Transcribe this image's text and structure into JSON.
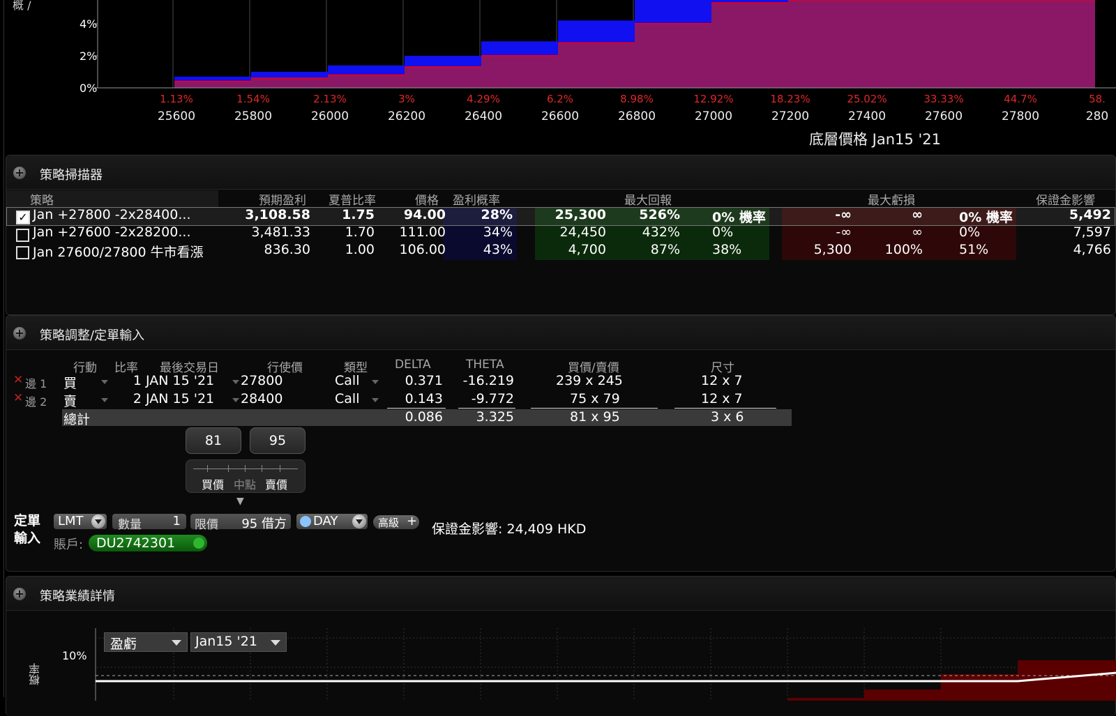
{
  "colors": {
    "profit_fill": "#8a1866",
    "loss_fill": "#1010f0",
    "step_line": "#e00020",
    "percent_red": "#e02828"
  },
  "top_chart": {
    "y_ticks": [
      "4%",
      "2%",
      "0%"
    ],
    "x_ticks": [
      "25600",
      "25800",
      "26000",
      "26200",
      "26400",
      "26600",
      "26800",
      "27000",
      "27200",
      "27400",
      "27600",
      "27800",
      "280"
    ],
    "x_percents": [
      "1.13%",
      "1.54%",
      "2.13%",
      "3%",
      "4.29%",
      "6.2%",
      "8.98%",
      "12.92%",
      "18.23%",
      "25.02%",
      "33.33%",
      "44.7%",
      "58."
    ],
    "xlabel": "底層價格 Jan15 '21"
  },
  "chart_data": {
    "type": "area",
    "x": [
      25500,
      25700,
      25900,
      26100,
      26300,
      26500,
      26700,
      26900,
      27100,
      27300,
      27500,
      27700,
      27900
    ],
    "series": [
      {
        "values": [
          0,
          0.4,
          0.6,
          0.8,
          1.3,
          2.0,
          2.8,
          4.0,
          5.3,
          6.0,
          6.0,
          6.0,
          6.0
        ]
      },
      {
        "values": [
          0,
          0.7,
          1.0,
          1.4,
          2.0,
          2.9,
          4.2,
          6.0,
          6.0,
          6.0,
          6.0,
          6.0,
          6.0
        ]
      }
    ],
    "title": "",
    "xlabel": "底層價格 Jan15 '21",
    "ylabel": "",
    "ylim": [
      0,
      5.5
    ]
  },
  "scanner": {
    "title": "策略掃描器",
    "headers": {
      "strategy": "策略",
      "expected_profit": "預期盈利",
      "sharpe": "夏普比率",
      "price": "價格",
      "pop": "盈利概率",
      "max_return": "最大回報",
      "max_loss": "最大虧損",
      "margin": "保證金影響"
    },
    "rows": [
      {
        "checked": true,
        "name": "Jan +27800 -2x28400...",
        "expected": "3,108.58",
        "sharpe": "1.75",
        "price": "94.00",
        "pop": "28%",
        "ret_amt": "25,300",
        "ret_pct": "526%",
        "ret_prob": "0% 機率",
        "loss_amt": "-∞",
        "loss_pct": "∞",
        "loss_prob": "0% 機率",
        "margin": "5,492"
      },
      {
        "checked": false,
        "name": "Jan +27600 -2x28200...",
        "expected": "3,481.33",
        "sharpe": "1.70",
        "price": "111.00",
        "pop": "34%",
        "ret_amt": "24,450",
        "ret_pct": "432%",
        "ret_prob": "0%",
        "loss_amt": "-∞",
        "loss_pct": "∞",
        "loss_prob": "0%",
        "margin": "7,597"
      },
      {
        "checked": false,
        "name": "Jan 27600/27800 牛市看漲",
        "expected": "836.30",
        "sharpe": "1.00",
        "price": "106.00",
        "pop": "43%",
        "ret_amt": "4,700",
        "ret_pct": "87%",
        "ret_prob": "38%",
        "loss_amt": "5,300",
        "loss_pct": "100%",
        "loss_prob": "51%",
        "margin": "4,766"
      }
    ]
  },
  "adjust": {
    "title": "策略調整/定單輸入",
    "headers": {
      "action": "行動",
      "ratio": "比率",
      "last_trade": "最後交易日",
      "strike": "行使價",
      "type": "類型",
      "delta": "DELTA",
      "theta": "THETA",
      "bid_ask": "買價/賣價",
      "size": "尺寸"
    },
    "legs": [
      {
        "label": "邊 1",
        "action": "買",
        "ratio": "1",
        "date": "JAN 15 '21",
        "strike": "27800",
        "type": "Call",
        "delta": "0.371",
        "theta": "-16.219",
        "bid_ask": "239 x 245",
        "size": "12 x 7"
      },
      {
        "label": "邊 2",
        "action": "賣",
        "ratio": "2",
        "date": "JAN 15 '21",
        "strike": "28400",
        "type": "Call",
        "delta": "0.143",
        "theta": "-9.772",
        "bid_ask": "75 x 79",
        "size": "12 x 7"
      }
    ],
    "total": {
      "label": "總計",
      "delta": "0.086",
      "theta": "3.325",
      "bid_ask": "81 x 95",
      "size": "3 x 6"
    },
    "slider": {
      "bid": "81",
      "ask": "95",
      "bid_label": "買價",
      "mid_label": "中點",
      "ask_label": "賣價"
    },
    "order": {
      "label_line1": "定單",
      "label_line2": "輸入",
      "order_type": "LMT",
      "qty_label": "數量",
      "qty": "1",
      "limit_label": "限價",
      "limit_value": "95 借方",
      "tif": "DAY",
      "advanced": "高級",
      "margin_text": "保證金影響: 24,409 HKD",
      "account_label": "賬戶:",
      "account": "DU2742301"
    }
  },
  "performance": {
    "title": "策略業績詳情",
    "dropdown1": "盈虧",
    "dropdown2": "Jan15 '21",
    "y_tick": "10%",
    "ylabel_partial": "概率"
  }
}
